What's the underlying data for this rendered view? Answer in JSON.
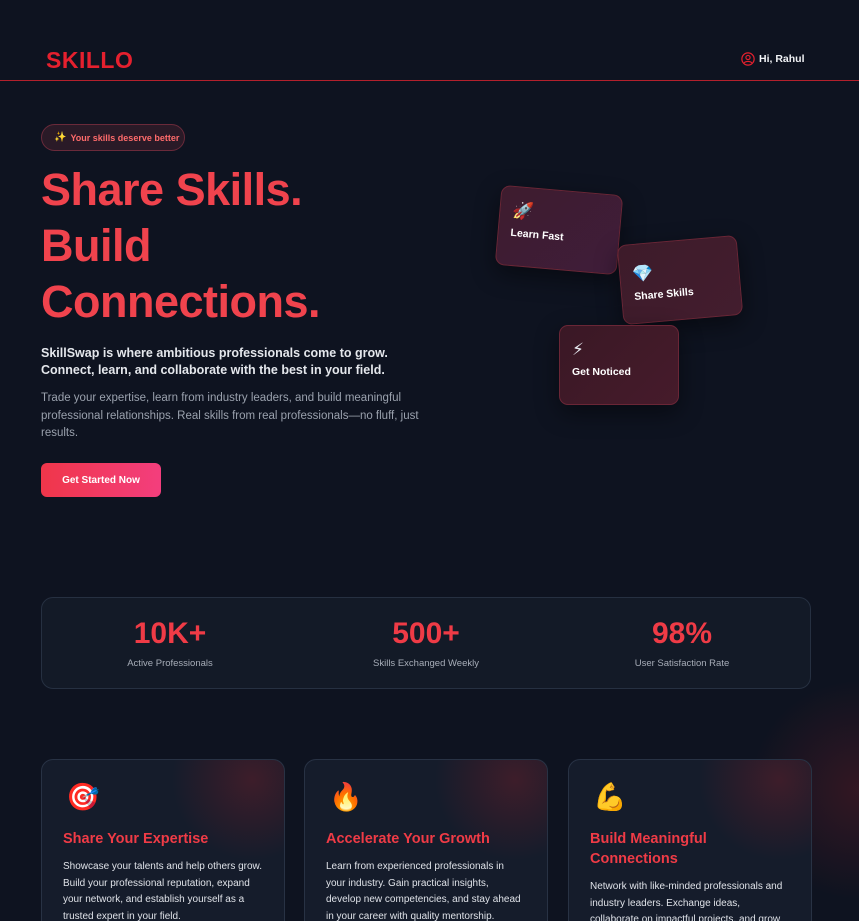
{
  "header": {
    "logo": "SKILLO",
    "greeting": "Hi, Rahul"
  },
  "hero": {
    "pill_icon": "✨",
    "pill_text": "Your skills deserve better",
    "headline": [
      "Share Skills.",
      "Build",
      "Connections."
    ],
    "lead": "SkillSwap is where ambitious professionals come to grow. Connect, learn, and collaborate with the best in your field.",
    "description": "Trade your expertise, learn from industry leaders, and build meaningful professional relationships. Real skills from real professionals—no fluff, just results.",
    "cta_label": "Get Started Now"
  },
  "floating_cards": [
    {
      "icon": "🚀",
      "icon_name": "rocket-icon",
      "label": "Learn Fast"
    },
    {
      "icon": "💎",
      "icon_name": "gem-icon",
      "label": "Share Skills"
    },
    {
      "icon": "⚡",
      "icon_name": "lightning-icon",
      "label": "Get Noticed"
    }
  ],
  "stats": [
    {
      "value": "10K+",
      "label": "Active Professionals"
    },
    {
      "value": "500+",
      "label": "Skills Exchanged Weekly"
    },
    {
      "value": "98%",
      "label": "User Satisfaction Rate"
    }
  ],
  "features": [
    {
      "icon": "🎯",
      "icon_name": "target-icon",
      "title": "Share Your Expertise",
      "text": "Showcase your talents and help others grow. Build your professional reputation, expand your network, and establish yourself as a trusted expert in your field."
    },
    {
      "icon": "🔥",
      "icon_name": "fire-icon",
      "title": "Accelerate Your Growth",
      "text": "Learn from experienced professionals in your industry. Gain practical insights, develop new competencies, and stay ahead in your career with quality mentorship."
    },
    {
      "icon": "💪",
      "icon_name": "flexed-biceps-icon",
      "title": "Build Meaningful Connections",
      "text": "Network with like-minded professionals and industry leaders. Exchange ideas, collaborate on impactful projects, and grow together."
    }
  ],
  "colors": {
    "accent": "#ef3b46",
    "background": "#0e1320",
    "cta_gradient_start": "#f0364a",
    "cta_gradient_end": "#f33e7d"
  }
}
